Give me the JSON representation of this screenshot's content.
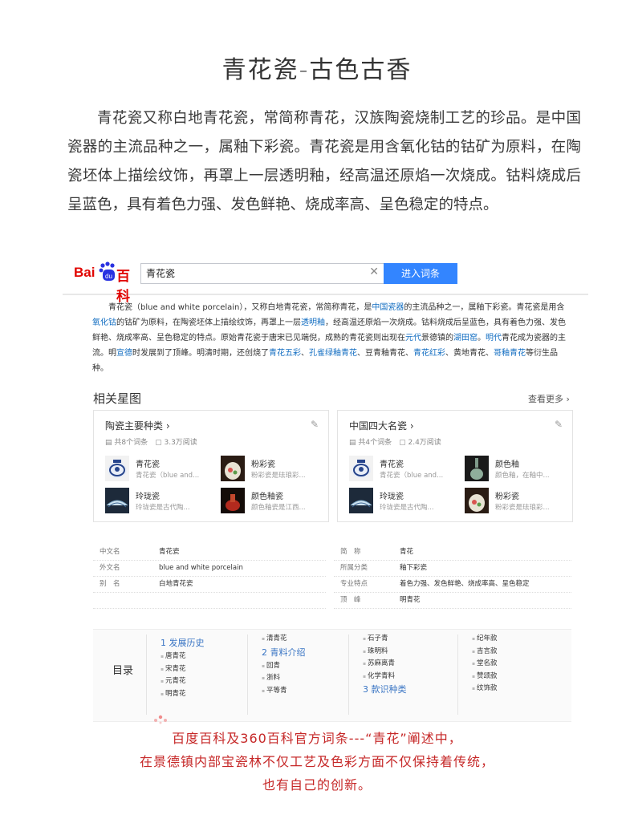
{
  "page": {
    "title": "青花瓷-古色古香",
    "intro": "青花瓷又称白地青花瓷，常简称青花，汉族陶瓷烧制工艺的珍品。是中国瓷器的主流品种之一，属釉下彩瓷。青花瓷是用含氧化钴的钴矿为原料，在陶瓷坯体上描绘纹饰，再罩上一层透明釉，经高温还原焰一次烧成。钴料烧成后呈蓝色，具有着色力强、发色鲜艳、烧成率高、呈色稳定的特点。",
    "footer": [
      "百度百科及360百科官方词条---“青花”阐述中，",
      "在景德镇内部宝瓷林不仅工艺及色彩方面不仅保持着传统，",
      "也有自己的创新。"
    ]
  },
  "baike": {
    "logo_left": "Bai",
    "logo_mid": "du",
    "logo_right": "百科",
    "search_value": "青花瓷",
    "enter_button": "进入词条",
    "summary": [
      {
        "t": "青花瓷（blue and white porcelain），又称白地青花瓷，常简称青花，是"
      },
      {
        "t": "中国瓷器",
        "link": true
      },
      {
        "t": "的主流品种之一，属釉下彩瓷。青花瓷是用含"
      },
      {
        "t": "氧化钴",
        "link": true
      },
      {
        "t": "的钴矿为原料，在陶瓷坯体上描绘纹饰，再罩上一层"
      },
      {
        "t": "透明釉",
        "link": true
      },
      {
        "t": "，经高温还原焰一次烧成。钴料烧成后呈蓝色，具有着色力强、发色鲜艳、烧成率高、呈色稳定的特点。原始青花瓷于唐宋已见端倪，成熟的青花瓷则出现在"
      },
      {
        "t": "元代",
        "link": true
      },
      {
        "t": "景德镇的"
      },
      {
        "t": "湖田窑",
        "link": true
      },
      {
        "t": "。"
      },
      {
        "t": "明代",
        "link": true
      },
      {
        "t": "青花成为瓷器的主流。明"
      },
      {
        "t": "宣德",
        "link": true
      },
      {
        "t": "时发展到了顶峰。明清时期，还创烧了"
      },
      {
        "t": "青花五彩",
        "link": true
      },
      {
        "t": "、"
      },
      {
        "t": "孔雀绿釉青花",
        "link": true
      },
      {
        "t": "、豆青釉青花、"
      },
      {
        "t": "青花红彩",
        "link": true
      },
      {
        "t": "、黄地青花、"
      },
      {
        "t": "哥釉青花",
        "link": true
      },
      {
        "t": "等衍生品种。"
      }
    ],
    "stars": {
      "title": "相关星图",
      "more": "查看更多",
      "cards": [
        {
          "title": "陶瓷主要种类",
          "count": "共8个词条",
          "reads": "3.3万阅读",
          "items": [
            {
              "name": "青花瓷",
              "desc": "青花瓷（blue and..."
            },
            {
              "name": "粉彩瓷",
              "desc": "粉彩瓷是珐琅彩..."
            },
            {
              "name": "玲珑瓷",
              "desc": "玲珑瓷是古代陶..."
            },
            {
              "name": "颜色釉瓷",
              "desc": "颜色釉瓷是江西..."
            }
          ]
        },
        {
          "title": "中国四大名瓷",
          "count": "共4个词条",
          "reads": "2.4万阅读",
          "items": [
            {
              "name": "青花瓷",
              "desc": "青花瓷（blue and..."
            },
            {
              "name": "颜色釉",
              "desc": "颜色釉，在釉中..."
            },
            {
              "name": "玲珑瓷",
              "desc": "玲珑瓷是古代陶..."
            },
            {
              "name": "粉彩瓷",
              "desc": "粉彩瓷是珐琅彩..."
            }
          ]
        }
      ]
    },
    "basic_info": {
      "left": [
        {
          "k": "中文名",
          "v": "青花瓷"
        },
        {
          "k": "外文名",
          "v": "blue and white porcelain"
        },
        {
          "k": "别　名",
          "v": "白地青花瓷"
        }
      ],
      "right": [
        {
          "k": "简　称",
          "v": "青花"
        },
        {
          "k": "所属分类",
          "v": "釉下彩瓷"
        },
        {
          "k": "专业特点",
          "v": "着色力强、发色鲜艳、烧成率高、呈色稳定"
        },
        {
          "k": "顶　峰",
          "v": "明青花"
        }
      ]
    },
    "toc": {
      "label": "目录",
      "col1": {
        "h1": "1  发展历史",
        "subs": [
          "唐青花",
          "宋青花",
          "元青花",
          "明青花"
        ]
      },
      "col2": {
        "pre": "清青花",
        "h2": "2  青料介绍",
        "subs": [
          "回青",
          "浙料",
          "平等青"
        ]
      },
      "col3": {
        "subs": [
          "石子青",
          "珠明料",
          "苏麻离青",
          "化学青料"
        ],
        "h3": "3  款识种类"
      },
      "col4": {
        "subs": [
          "纪年款",
          "吉言款",
          "堂名款",
          "赞颂款",
          "纹饰款"
        ]
      }
    }
  }
}
